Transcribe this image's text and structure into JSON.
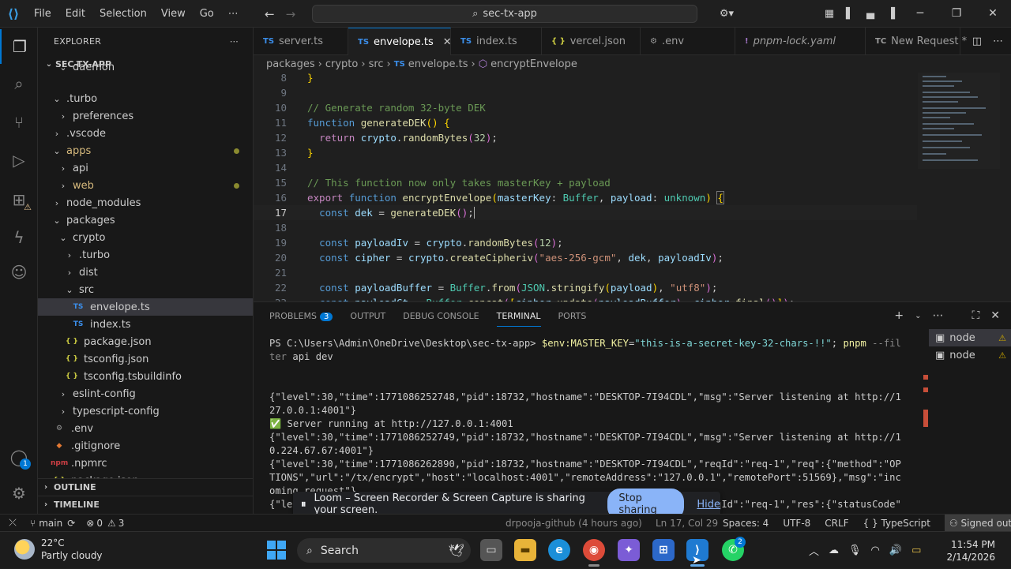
{
  "titlebar": {
    "menu": [
      "File",
      "Edit",
      "Selection",
      "View",
      "Go",
      "⋯"
    ],
    "search_text": "sec-tx-app"
  },
  "activity": {
    "scm_badge": "",
    "accounts_badge": "1"
  },
  "sidebar": {
    "title": "EXPLORER",
    "root": "SEC-TX-APP",
    "items": [
      {
        "label": "daemon",
        "indent": 2,
        "type": "folder-cut"
      },
      {
        "label": ".turbo",
        "indent": 1,
        "type": "folder-open"
      },
      {
        "label": "preferences",
        "indent": 2,
        "type": "folder"
      },
      {
        "label": ".vscode",
        "indent": 1,
        "type": "folder"
      },
      {
        "label": "apps",
        "indent": 1,
        "type": "folder-open",
        "modified": true
      },
      {
        "label": "api",
        "indent": 2,
        "type": "folder"
      },
      {
        "label": "web",
        "indent": 2,
        "type": "folder",
        "modified": true
      },
      {
        "label": "node_modules",
        "indent": 1,
        "type": "folder"
      },
      {
        "label": "packages",
        "indent": 1,
        "type": "folder-open"
      },
      {
        "label": "crypto",
        "indent": 2,
        "type": "folder-open"
      },
      {
        "label": ".turbo",
        "indent": 3,
        "type": "folder"
      },
      {
        "label": "dist",
        "indent": 3,
        "type": "folder"
      },
      {
        "label": "src",
        "indent": 3,
        "type": "folder-open"
      },
      {
        "label": "envelope.ts",
        "indent": 4,
        "type": "ts",
        "selected": true
      },
      {
        "label": "index.ts",
        "indent": 4,
        "type": "ts"
      },
      {
        "label": "package.json",
        "indent": 3,
        "type": "json"
      },
      {
        "label": "tsconfig.json",
        "indent": 3,
        "type": "json"
      },
      {
        "label": "tsconfig.tsbuildinfo",
        "indent": 3,
        "type": "json"
      },
      {
        "label": "eslint-config",
        "indent": 2,
        "type": "folder"
      },
      {
        "label": "typescript-config",
        "indent": 2,
        "type": "folder"
      },
      {
        "label": ".env",
        "indent": 1,
        "type": "env"
      },
      {
        "label": ".gitignore",
        "indent": 1,
        "type": "git"
      },
      {
        "label": ".npmrc",
        "indent": 1,
        "type": "npm"
      },
      {
        "label": "package.json",
        "indent": 1,
        "type": "json"
      }
    ],
    "outline": "OUTLINE",
    "timeline": "TIMELINE"
  },
  "tabs": [
    {
      "label": "server.ts",
      "icon": "TS",
      "icon_color": "#3b8eea",
      "active": false
    },
    {
      "label": "envelope.ts",
      "icon": "TS",
      "icon_color": "#3b8eea",
      "active": true
    },
    {
      "label": "index.ts",
      "icon": "TS",
      "icon_color": "#3b8eea",
      "active": false
    },
    {
      "label": "vercel.json",
      "icon": "{ }",
      "icon_color": "#cbcb41",
      "active": false
    },
    {
      "label": ".env",
      "icon": "⚙",
      "icon_color": "#9d9d9d",
      "active": false
    },
    {
      "label": "pnpm-lock.yaml",
      "icon": "!",
      "icon_color": "#a074c4",
      "active": false,
      "italic": true
    },
    {
      "label": "New Request *",
      "icon": "TC",
      "icon_color": "#9d9d9d",
      "active": false
    }
  ],
  "breadcrumb": [
    "packages",
    "crypto",
    "src",
    "envelope.ts",
    "encryptEnvelope"
  ],
  "editor": {
    "current_line": 17
  },
  "panel": {
    "tabs": [
      "PROBLEMS",
      "OUTPUT",
      "DEBUG CONSOLE",
      "TERMINAL",
      "PORTS"
    ],
    "problems_count": "3",
    "active_tab": "TERMINAL",
    "terminals": [
      "node",
      "node"
    ]
  },
  "loom": {
    "message": "Loom – Screen Recorder & Screen Capture is sharing your screen.",
    "stop": "Stop sharing",
    "hide": "Hide"
  },
  "statusbar": {
    "branch": "main",
    "errors": "0",
    "warnings": "3",
    "blame": "drpooja-github (4 hours ago)",
    "position": "Ln 17, Col 29",
    "spaces": "Spaces: 4",
    "encoding": "UTF-8",
    "eol": "CRLF",
    "language": "TypeScript",
    "signed": "Signed out"
  },
  "taskbar": {
    "temp": "22°C",
    "weather": "Partly cloudy",
    "search": "Search",
    "time": "11:54 PM",
    "date": "2/14/2026",
    "whatsapp_badge": "2"
  }
}
